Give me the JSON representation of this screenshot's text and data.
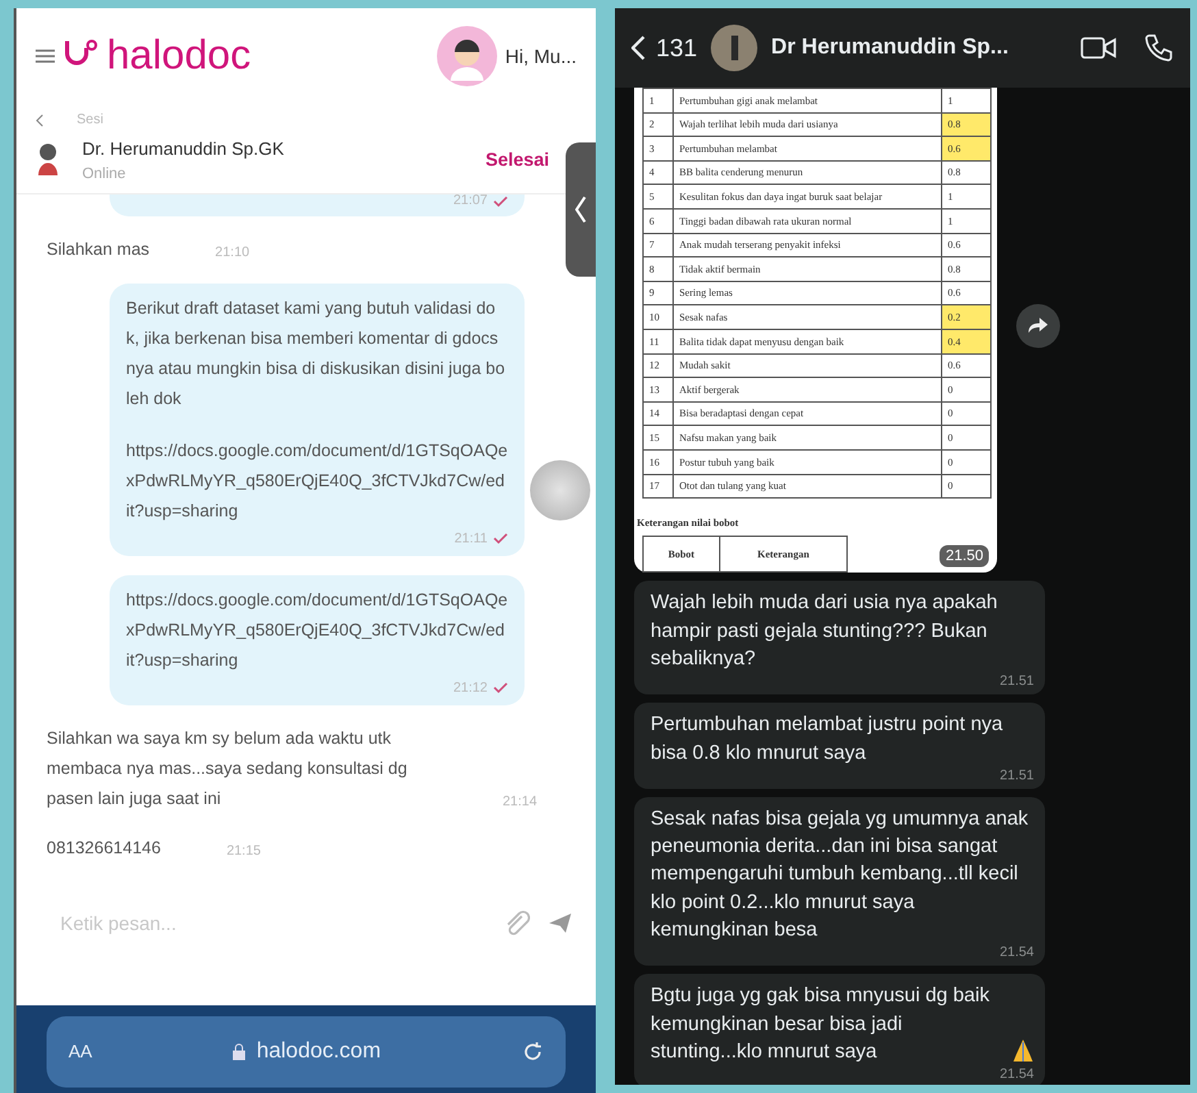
{
  "left_screen": {
    "header": {
      "brand": "halodoc",
      "greeting": "Hi, Mu..."
    },
    "session": {
      "back_label": "Sesi",
      "doctor_name": "Dr. Herumanuddin Sp.GK",
      "status": "Online",
      "action": "Selesai"
    },
    "messages": [
      {
        "kind": "partial",
        "time": "21:07"
      },
      {
        "kind": "received",
        "paragraphs": [
          "Silahkan mas"
        ],
        "time": "21:10"
      },
      {
        "kind": "sent",
        "paragraphs": [
          "Berikut draft dataset kami yang butuh validasi dok, jika berkenan bisa memberi komentar di gdocs nya atau mungkin bisa di diskusikan disini juga boleh dok",
          "https://docs.google.com/document/d/1GTSqOAQexPdwRLMyYR_q580ErQjE40Q_3fCTVJkd7Cw/edit?usp=sharing"
        ],
        "time": "21:11"
      },
      {
        "kind": "sent",
        "paragraphs": [
          "https://docs.google.com/document/d/1GTSqOAQexPdwRLMyYR_q580ErQjE40Q_3fCTVJkd7Cw/edit?usp=sharing"
        ],
        "time": "21:12"
      },
      {
        "kind": "received",
        "paragraphs": [
          "Silahkan wa saya km sy belum ada waktu utk membaca nya mas...saya sedang konsultasi dg pasen lain juga saat ini"
        ],
        "time": "21:14"
      },
      {
        "kind": "received",
        "paragraphs": [
          "081326614146"
        ],
        "time": "21:15"
      }
    ],
    "composer": {
      "placeholder": "Ketik pesan..."
    },
    "browser_bar": {
      "text_size": "AA",
      "url": "halodoc.com"
    }
  },
  "right_screen": {
    "header": {
      "back_count": "131",
      "contact": "Dr Herumanuddin Sp..."
    },
    "image_message": {
      "rows": [
        {
          "no": "1",
          "item": "Pertumbuhan gigi anak melambat",
          "value": "1",
          "highlighted": false
        },
        {
          "no": "2",
          "item": "Wajah terlihat lebih muda dari usianya",
          "value": "0.8",
          "highlighted": true
        },
        {
          "no": "3",
          "item": "Pertumbuhan melambat",
          "value": "0.6",
          "highlighted": true
        },
        {
          "no": "4",
          "item": "BB balita cenderung menurun",
          "value": "0.8",
          "highlighted": false
        },
        {
          "no": "5",
          "item": "Kesulitan fokus dan daya ingat buruk saat belajar",
          "value": "1",
          "highlighted": false
        },
        {
          "no": "6",
          "item": "Tinggi badan dibawah rata ukuran normal",
          "value": "1",
          "highlighted": false
        },
        {
          "no": "7",
          "item": "Anak mudah terserang penyakit infeksi",
          "value": "0.6",
          "highlighted": false
        },
        {
          "no": "8",
          "item": "Tidak aktif bermain",
          "value": "0.8",
          "highlighted": false
        },
        {
          "no": "9",
          "item": "Sering lemas",
          "value": "0.6",
          "highlighted": false
        },
        {
          "no": "10",
          "item": "Sesak nafas",
          "value": "0.2",
          "highlighted": true
        },
        {
          "no": "11",
          "item": "Balita tidak dapat menyusu dengan baik",
          "value": "0.4",
          "highlighted": true
        },
        {
          "no": "12",
          "item": "Mudah sakit",
          "value": "0.6",
          "highlighted": false
        },
        {
          "no": "13",
          "item": "Aktif bergerak",
          "value": "0",
          "highlighted": false
        },
        {
          "no": "14",
          "item": "Bisa beradaptasi dengan cepat",
          "value": "0",
          "highlighted": false
        },
        {
          "no": "15",
          "item": "Nafsu makan yang baik",
          "value": "0",
          "highlighted": false
        },
        {
          "no": "16",
          "item": "Postur tubuh yang baik",
          "value": "0",
          "highlighted": false
        },
        {
          "no": "17",
          "item": "Otot dan tulang yang kuat",
          "value": "0",
          "highlighted": false
        }
      ],
      "note_title": "Keterangan nilai bobot",
      "note_columns": [
        "Bobot",
        "Keterangan"
      ],
      "time": "21.50"
    },
    "messages": [
      {
        "text": "Wajah lebih muda dari usia nya apakah hampir pasti gejala stunting??? Bukan sebaliknya?",
        "time": "21.51"
      },
      {
        "text": "Pertumbuhan melambat justru point nya bisa 0.8 klo mnurut saya",
        "time": "21.51"
      },
      {
        "text": "Sesak nafas bisa gejala yg umumnya anak peneumonia derita...dan ini bisa sangat mempengaruhi tumbuh kembang...tll kecil klo point 0.2...klo mnurut saya kemungkinan besa",
        "time": "21.54"
      },
      {
        "text": "Bgtu juga yg gak bisa mnyusui dg baik kemungkinan besar  bisa jadi stunting...klo mnurut saya",
        "time": "21.54"
      }
    ]
  }
}
